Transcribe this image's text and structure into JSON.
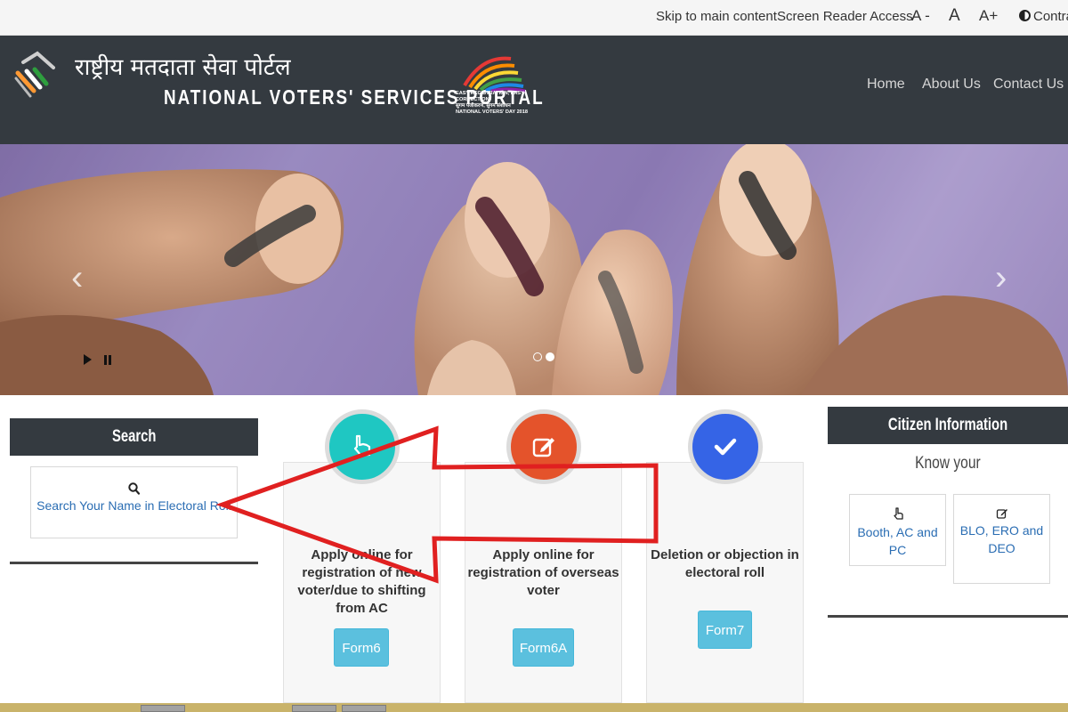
{
  "topbar": {
    "skip_link": "Skip to main content",
    "screen_reader": "Screen Reader Access",
    "font_decrease": "A -",
    "font_normal": "A",
    "font_increase": "A+",
    "contrast": "Contra"
  },
  "header": {
    "title_hindi": "राष्ट्रीय मतदाता सेवा पोर्टल",
    "title_english": "NATIONAL VOTERS' SERVICES PORTAL",
    "event_logo_lines": [
      "EASY REGISTRATION, EASY CORRECTION",
      "सुगम पंजीकरण, सुगम संशोधन",
      "NATIONAL VOTERS' DAY 2018"
    ],
    "nav": [
      "Home",
      "About Us",
      "Contact Us"
    ]
  },
  "banner": {
    "slides": 2,
    "active_slide": 2
  },
  "search": {
    "heading": "Search",
    "link_label": "Search Your Name in Electoral Roll"
  },
  "services": [
    {
      "description": "Apply online for registration of new voter/due to shifting from AC",
      "button": "Form6",
      "icon": "hand-pointer-icon",
      "color": "#1fc7c2"
    },
    {
      "description": "Apply online for registration of overseas voter",
      "button": "Form6A",
      "icon": "edit-icon",
      "color": "#e4532b"
    },
    {
      "description": "Deletion or objection in electoral roll",
      "button": "Form7",
      "icon": "check-icon",
      "color": "#3564e6"
    }
  ],
  "citizen": {
    "heading": "Citizen Information",
    "subheading": "Know your",
    "items": [
      "Booth, AC and PC",
      "BLO, ERO and DEO"
    ]
  },
  "colors": {
    "header_bg": "#343a40",
    "button": "#5bc0de",
    "link": "#2a6db3",
    "annotation_arrow": "#e02020"
  }
}
